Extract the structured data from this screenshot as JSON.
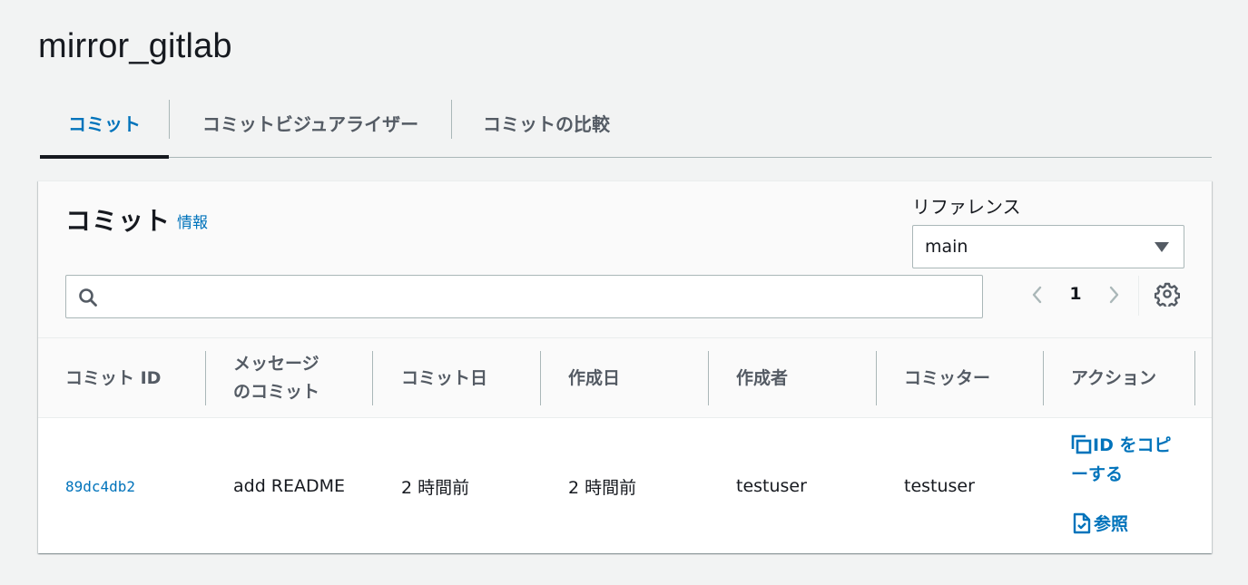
{
  "repo": {
    "title": "mirror_gitlab"
  },
  "tabs": [
    {
      "label": "コミット",
      "active": true
    },
    {
      "label": "コミットビジュアライザー",
      "active": false
    },
    {
      "label": "コミットの比較",
      "active": false
    }
  ],
  "panel": {
    "title": "コミット",
    "info_link": "情報",
    "reference_label": "リファレンス",
    "reference_value": "main",
    "search_placeholder": "",
    "page_number": "1"
  },
  "table": {
    "headers": [
      "コミット ID",
      "メッセージのコミット",
      "コミット日",
      "作成日",
      "作成者",
      "コミッター",
      "アクション"
    ],
    "header_message_line1": "メッセージ",
    "header_message_line2": "のコミット",
    "rows": [
      {
        "commit_id": "89dc4db2",
        "message": "add README",
        "commit_date": "2 時間前",
        "created_date": "2 時間前",
        "author": "testuser",
        "committer": "testuser",
        "action_copy": "ID をコピーする",
        "action_copy_line1": "ID をコピ",
        "action_copy_line2": "ーする",
        "action_view": "参照"
      }
    ]
  },
  "colors": {
    "link": "#0073bb",
    "text": "#16191f",
    "muted": "#545b64",
    "background": "#f2f3f3"
  }
}
